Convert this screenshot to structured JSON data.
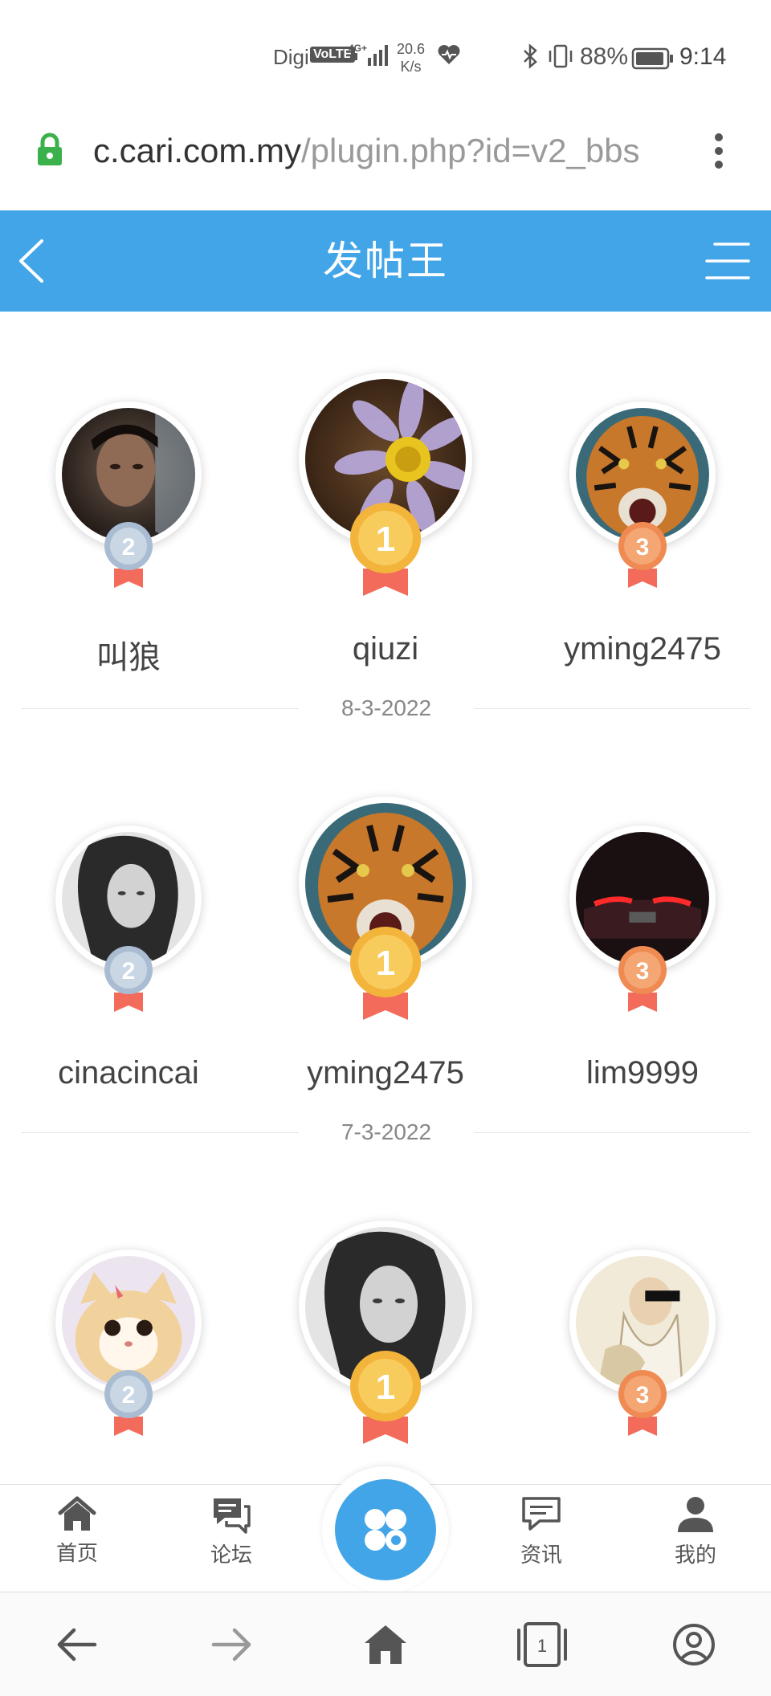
{
  "status_bar": {
    "carrier": "Digi",
    "volte": "VoLTE",
    "network": "4G+",
    "speed_value": "20.6",
    "speed_unit": "K/s",
    "battery": "88%",
    "time": "9:14"
  },
  "url_bar": {
    "domain": "c.cari.com.my",
    "path": "/plugin.php?id=v2_bbs"
  },
  "header": {
    "title": "发帖王"
  },
  "ranking_groups": [
    {
      "rank2": {
        "name": "叫狼",
        "badge": "2"
      },
      "rank1": {
        "name": "qiuzi",
        "badge": "1"
      },
      "rank3": {
        "name": "yming2475",
        "badge": "3"
      },
      "date": "8-3-2022"
    },
    {
      "rank2": {
        "name": "cinacincai",
        "badge": "2"
      },
      "rank1": {
        "name": "yming2475",
        "badge": "1"
      },
      "rank3": {
        "name": "lim9999",
        "badge": "3"
      },
      "date": "7-3-2022"
    },
    {
      "rank2": {
        "name": "",
        "badge": "2"
      },
      "rank1": {
        "name": "",
        "badge": "1"
      },
      "rank3": {
        "name": "",
        "badge": "3"
      }
    }
  ],
  "bottom_nav": {
    "home": "首页",
    "forum": "论坛",
    "news": "资讯",
    "mine": "我的"
  },
  "browser_bar": {
    "tab_count": "1"
  },
  "colors": {
    "accent": "#42a5e8",
    "gold": "#f3b43c",
    "silver": "#a9bcd2",
    "bronze": "#ee8a52",
    "ribbon": "#f26b5b"
  }
}
